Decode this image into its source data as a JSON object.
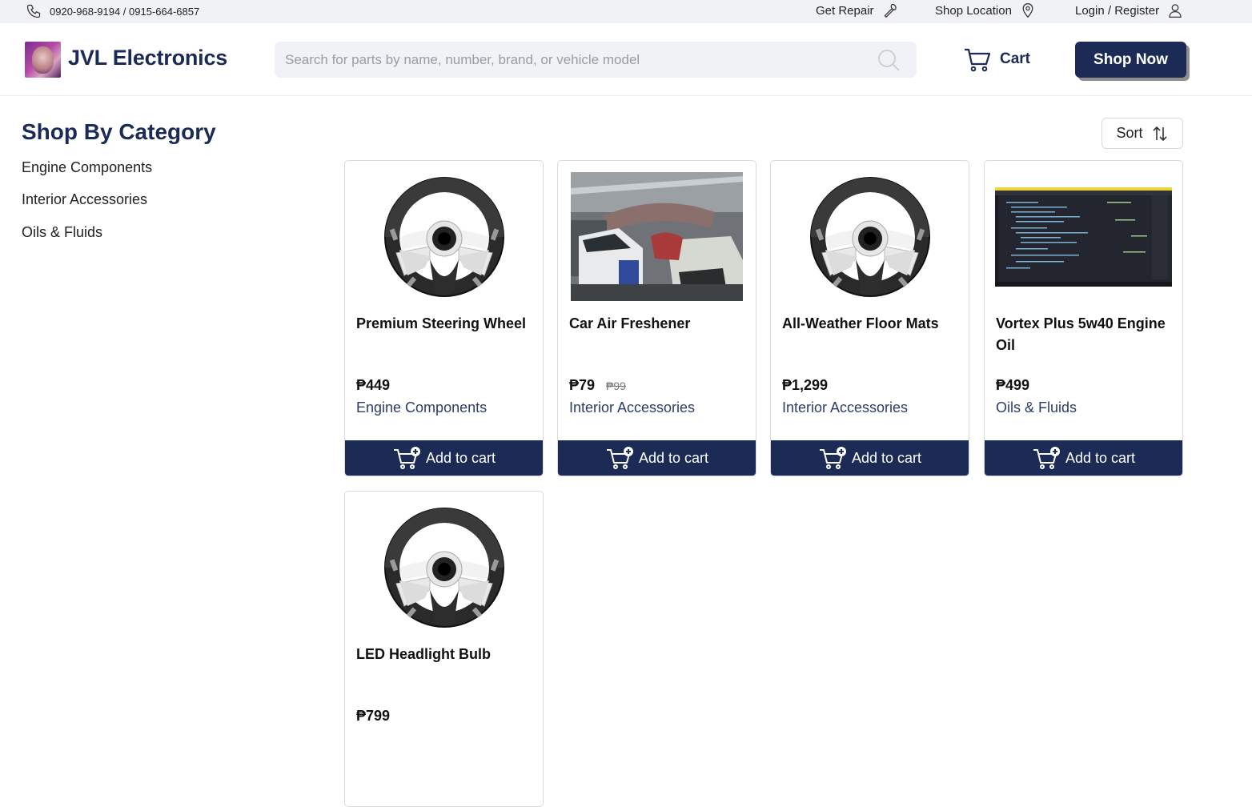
{
  "topbar": {
    "phone": "0920-968-9194 / 0915-664-6857",
    "get_repair": "Get Repair",
    "shop_location": "Shop Location",
    "login": "Login / Register"
  },
  "header": {
    "brand": "JVL Electronics",
    "search_placeholder": "Search for parts by name, number, brand, or vehicle model",
    "cart": "Cart",
    "shop_now": "Shop Now"
  },
  "sidebar": {
    "title": "Shop By Category",
    "categories": [
      "Engine Components",
      "Interior Accessories",
      "Oils & Fluids"
    ]
  },
  "sort": {
    "label": "Sort"
  },
  "add_label": "Add to cart",
  "products": [
    {
      "name": "Premium Steering Wheel",
      "price": "₱449",
      "old_price": "",
      "category": "Engine Components",
      "image": "steering-wheel"
    },
    {
      "name": "Car Air Freshener",
      "price": "₱79",
      "old_price": "₱99",
      "category": "Interior Accessories",
      "image": "garage-photo"
    },
    {
      "name": "All-Weather Floor Mats",
      "price": "₱1,299",
      "old_price": "",
      "category": "Interior Accessories",
      "image": "steering-wheel"
    },
    {
      "name": "Vortex Plus 5w40 Engine Oil",
      "price": "₱499",
      "old_price": "",
      "category": "Oils & Fluids",
      "image": "code-editor-screenshot"
    },
    {
      "name": "LED Headlight Bulb",
      "price": "₱799",
      "old_price": "",
      "category": "",
      "image": "steering-wheel"
    }
  ],
  "colors": {
    "navy": "#1c2b55",
    "topbar_bg": "#f1f2f5",
    "search_bg": "#f1f2f6"
  }
}
